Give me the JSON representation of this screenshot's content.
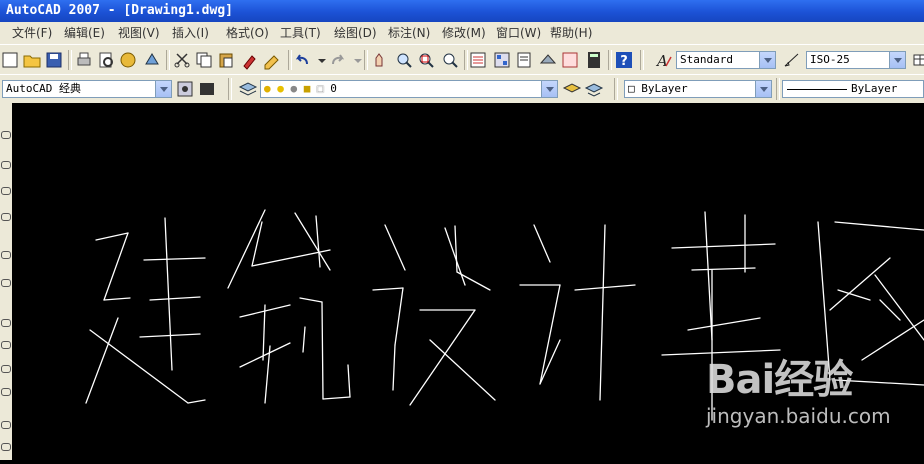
{
  "window": {
    "title": "AutoCAD 2007 - [Drawing1.dwg]"
  },
  "menu": {
    "items": [
      "文件(F)",
      "编辑(E)",
      "视图(V)",
      "插入(I)",
      "格式(O)",
      "工具(T)",
      "绘图(D)",
      "标注(N)",
      "修改(M)",
      "窗口(W)",
      "帮助(H)"
    ]
  },
  "toolbar": {
    "text_style": "Standard",
    "dim_style": "ISO-25",
    "workspace": "AutoCAD 经典",
    "layer": "0",
    "color": "ByLayer",
    "linetype": "ByLayer"
  },
  "drawing": {
    "text": "建筑设计草图",
    "stroke_color": "#ffffff"
  },
  "watermark": {
    "logo": "Bai经验",
    "url": "jingyan.baidu.com"
  }
}
